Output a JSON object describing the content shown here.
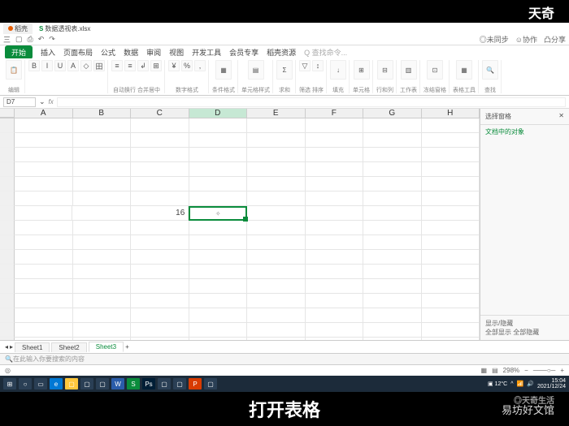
{
  "letterbox": {
    "top_right": "天奇",
    "caption": "打开表格",
    "watermark": "易坊好文馆",
    "watermark2": "◎天奇生活"
  },
  "titlebar": {
    "tab1": "稻壳",
    "tab2": "数据透视表.xlsx"
  },
  "qat": {
    "menu": "三",
    "sync_label": "◎未同步",
    "coop_label": "☺协作",
    "share_label": "凸分享"
  },
  "ribbon_tabs": {
    "file": "开始",
    "t1": "插入",
    "t2": "页面布局",
    "t3": "公式",
    "t4": "数据",
    "t5": "审阅",
    "t6": "视图",
    "t7": "开发工具",
    "t8": "会员专享",
    "t9": "稻壳资源",
    "search": "Q 查找命令..."
  },
  "ribbon_groups": {
    "g1": "编辑",
    "g2": "自动换行 合并居中",
    "g3": "数字格式",
    "g4": "条件格式",
    "g5": "单元格样式",
    "g6": "求和",
    "g7": "筛选 排序",
    "g8": "填充",
    "g9": "单元格",
    "g10": "行和列",
    "g11": "工作表",
    "g12": "冻结窗格",
    "g13": "表格工具",
    "g14": "查找"
  },
  "formula_bar": {
    "name": "D7",
    "fx": "fx"
  },
  "columns": [
    "A",
    "B",
    "C",
    "D",
    "E",
    "F",
    "G",
    "H"
  ],
  "cells": {
    "C7": "16"
  },
  "active_cell": "D7",
  "sidepanel": {
    "title": "选择窗格",
    "close": "✕",
    "subtitle": "文档中的对象",
    "footer1": "显示/隐藏",
    "footer2": "全部显示  全部隐藏"
  },
  "sheet_tabs": {
    "s1": "Sheet1",
    "s2": "Sheet2",
    "s3": "Sheet3",
    "add": "+"
  },
  "search_bar": {
    "placeholder": "在此输入你要搜索的内容"
  },
  "status": {
    "zoom": "298%",
    "mode": "◎"
  },
  "taskbar": {
    "temp": "▣ 12°C",
    "time": "15:04",
    "date": "2021/12/24"
  }
}
